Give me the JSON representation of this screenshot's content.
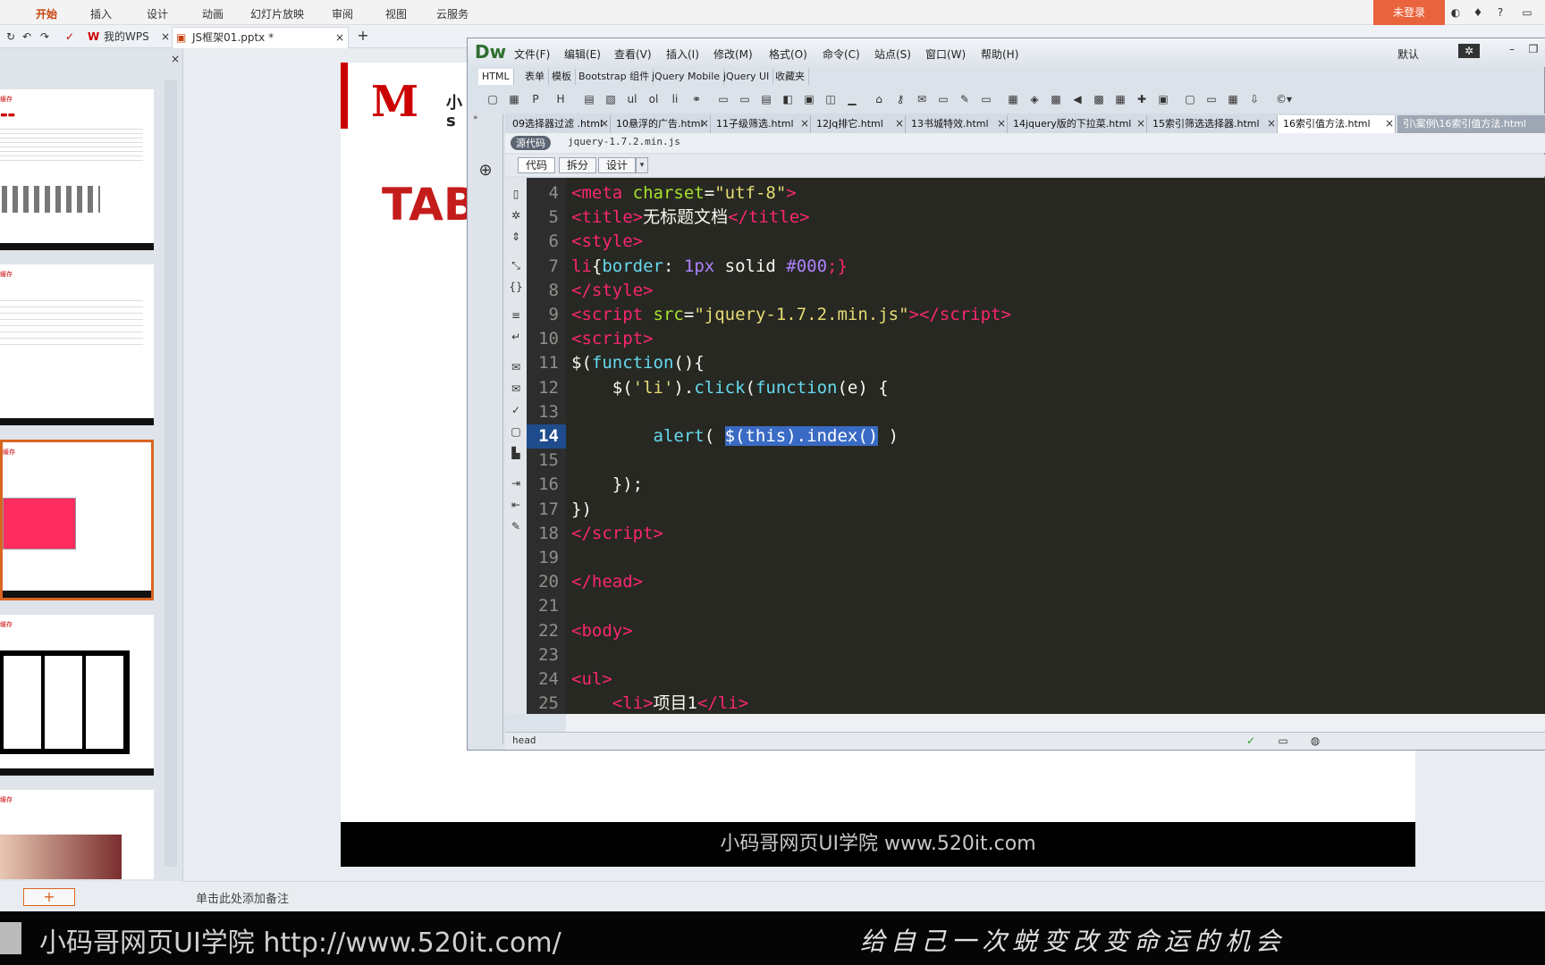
{
  "wps": {
    "ribbon_tabs": [
      "开始",
      "插入",
      "设计",
      "动画",
      "幻灯片放映",
      "审阅",
      "视图",
      "云服务"
    ],
    "login_label": "未登录",
    "doc_tabs": [
      "我的WPS",
      "JS框架01.pptx *"
    ],
    "notes_placeholder": "单击此处添加备注",
    "slide_title_partial": "TAB",
    "slide_logo_partial": "小\ns",
    "slide_footer": "小码哥网页UI学院   www.520it.com",
    "thumbnails": [
      "缓存",
      "缓存",
      "缓存",
      "缓存",
      "缓存"
    ],
    "add_slide_label": "+"
  },
  "dw": {
    "logo": "Dw",
    "menus": [
      "文件(F)",
      "编辑(E)",
      "查看(V)",
      "插入(I)",
      "修改(M)",
      "格式(O)",
      "命令(C)",
      "站点(S)",
      "窗口(W)",
      "帮助(H)"
    ],
    "workspace_label": "默认",
    "insert_tabs": [
      "HTML",
      "表单",
      "模板",
      "Bootstrap 组件",
      "jQuery Mobile",
      "jQuery UI",
      "收藏夹"
    ],
    "file_tabs": [
      "09选择器过滤 .html",
      "10悬浮的广告.html",
      "11子级筛选.html",
      "12Jq排它.html",
      "13书城特效.html",
      "14jquery版的下拉菜.html",
      "15索引筛选选择器.html",
      "16索引值方法.html",
      "引\\案例\\16索引值方法.html"
    ],
    "related_files": [
      "源代码",
      "jquery-1.7.2.min.js"
    ],
    "view_buttons": [
      "代码",
      "拆分",
      "设计"
    ],
    "status_tag": "head",
    "code_lines": [
      {
        "n": "4",
        "html": "<span class='t'>&lt;meta</span> <span class='a'>charset</span><span class='w'>=</span><span class='s'>\"utf-8\"</span><span class='t'>&gt;</span>"
      },
      {
        "n": "5",
        "html": "<span class='t'>&lt;title&gt;</span><span class='w'>无标题文档</span><span class='t'>&lt;/title&gt;</span>"
      },
      {
        "n": "6",
        "html": "<span class='t'>&lt;style&gt;</span>"
      },
      {
        "n": "7",
        "html": "<span class='t'>li</span><span class='w'>{</span><span class='k'>border</span><span class='w'>: </span><span class='n'>1px</span><span class='w'> solid </span><span class='n'>#000</span><span class='t'>;}</span>"
      },
      {
        "n": "8",
        "html": "<span class='t'>&lt;/style&gt;</span>"
      },
      {
        "n": "9",
        "html": "<span class='t'>&lt;script</span> <span class='a'>src</span><span class='w'>=</span><span class='s'>\"jquery-1.7.2.min.js\"</span><span class='t'>&gt;&lt;/script&gt;</span>"
      },
      {
        "n": "10",
        "html": "<span class='t'>&lt;script&gt;</span>"
      },
      {
        "n": "11",
        "html": "<span class='w'>$(</span><span class='k'>function</span><span class='w'>(){</span>"
      },
      {
        "n": "12",
        "html": "    <span class='w'>$(</span><span class='s'>'li'</span><span class='w'>).</span><span class='k'>click</span><span class='w'>(</span><span class='k'>function</span><span class='w'>(e) {</span>"
      },
      {
        "n": "13",
        "html": ""
      },
      {
        "n": "14",
        "html": "        <span class='k'>alert</span><span class='w'>( </span><span class='sel'>$(this).index()</span><span class='w'> )</span>"
      },
      {
        "n": "15",
        "html": ""
      },
      {
        "n": "16",
        "html": "    <span class='w'>});</span>"
      },
      {
        "n": "17",
        "html": "<span class='w'>})</span>"
      },
      {
        "n": "18",
        "html": "<span class='t'>&lt;/script&gt;</span>"
      },
      {
        "n": "19",
        "html": ""
      },
      {
        "n": "20",
        "html": "<span class='t'>&lt;/head&gt;</span>"
      },
      {
        "n": "21",
        "html": ""
      },
      {
        "n": "22",
        "html": "<span class='t'>&lt;body&gt;</span>"
      },
      {
        "n": "23",
        "html": ""
      },
      {
        "n": "24",
        "html": "<span class='t'>&lt;ul&gt;</span>"
      },
      {
        "n": "25",
        "html": "    <span class='t'>&lt;li&gt;</span><span class='w'>项目1</span><span class='t'>&lt;/li&gt;</span>"
      }
    ],
    "current_line": "14"
  },
  "brand": {
    "left": "小码哥网页UI学院  http://www.520it.com/",
    "right": "给自己一次蜕变改变命运的机会"
  },
  "colors": {
    "accent": "#c8410c",
    "code_bg": "#272822",
    "selection": "#3a6bc4"
  }
}
